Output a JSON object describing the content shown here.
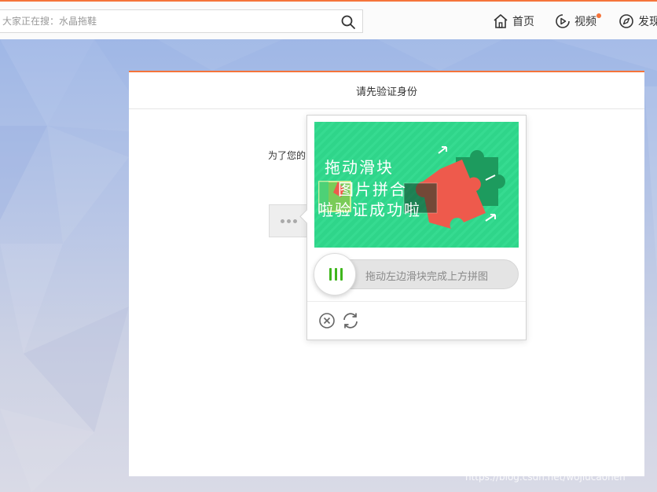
{
  "topbar": {
    "search_placeholder": "大家正在搜：水晶拖鞋",
    "nav": [
      {
        "label": "首页",
        "icon": "home-icon"
      },
      {
        "label": "视频",
        "icon": "play-icon",
        "has_badge": true
      },
      {
        "label": "发现",
        "icon": "compass-icon"
      }
    ],
    "accent_color": "#f5743a"
  },
  "dialog": {
    "title": "请先验证身份",
    "description": "为了您的"
  },
  "captcha": {
    "image_text": [
      "拖动滑块",
      "图片拼合",
      "啦验证成功啦"
    ],
    "slider_hint": "拖动左边滑块完成上方拼图",
    "image_bg_color": "#2fd58a",
    "handle_color": "#3fb61c"
  },
  "watermark": "https://blog.csdn.net/wojiucaonen"
}
